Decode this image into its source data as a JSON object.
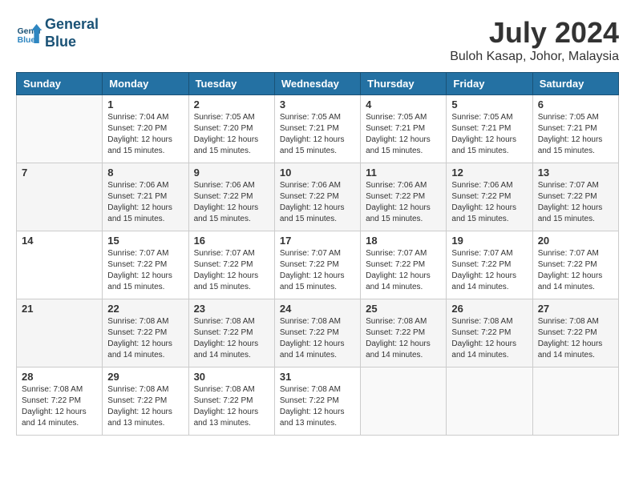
{
  "header": {
    "logo_line1": "General",
    "logo_line2": "Blue",
    "month_year": "July 2024",
    "location": "Buloh Kasap, Johor, Malaysia"
  },
  "days_of_week": [
    "Sunday",
    "Monday",
    "Tuesday",
    "Wednesday",
    "Thursday",
    "Friday",
    "Saturday"
  ],
  "weeks": [
    [
      {
        "day": "",
        "info": ""
      },
      {
        "day": "1",
        "info": "Sunrise: 7:04 AM\nSunset: 7:20 PM\nDaylight: 12 hours\nand 15 minutes."
      },
      {
        "day": "2",
        "info": "Sunrise: 7:05 AM\nSunset: 7:20 PM\nDaylight: 12 hours\nand 15 minutes."
      },
      {
        "day": "3",
        "info": "Sunrise: 7:05 AM\nSunset: 7:21 PM\nDaylight: 12 hours\nand 15 minutes."
      },
      {
        "day": "4",
        "info": "Sunrise: 7:05 AM\nSunset: 7:21 PM\nDaylight: 12 hours\nand 15 minutes."
      },
      {
        "day": "5",
        "info": "Sunrise: 7:05 AM\nSunset: 7:21 PM\nDaylight: 12 hours\nand 15 minutes."
      },
      {
        "day": "6",
        "info": "Sunrise: 7:05 AM\nSunset: 7:21 PM\nDaylight: 12 hours\nand 15 minutes."
      }
    ],
    [
      {
        "day": "7",
        "info": ""
      },
      {
        "day": "8",
        "info": "Sunrise: 7:06 AM\nSunset: 7:21 PM\nDaylight: 12 hours\nand 15 minutes."
      },
      {
        "day": "9",
        "info": "Sunrise: 7:06 AM\nSunset: 7:22 PM\nDaylight: 12 hours\nand 15 minutes."
      },
      {
        "day": "10",
        "info": "Sunrise: 7:06 AM\nSunset: 7:22 PM\nDaylight: 12 hours\nand 15 minutes."
      },
      {
        "day": "11",
        "info": "Sunrise: 7:06 AM\nSunset: 7:22 PM\nDaylight: 12 hours\nand 15 minutes."
      },
      {
        "day": "12",
        "info": "Sunrise: 7:06 AM\nSunset: 7:22 PM\nDaylight: 12 hours\nand 15 minutes."
      },
      {
        "day": "13",
        "info": "Sunrise: 7:07 AM\nSunset: 7:22 PM\nDaylight: 12 hours\nand 15 minutes."
      }
    ],
    [
      {
        "day": "14",
        "info": ""
      },
      {
        "day": "15",
        "info": "Sunrise: 7:07 AM\nSunset: 7:22 PM\nDaylight: 12 hours\nand 15 minutes."
      },
      {
        "day": "16",
        "info": "Sunrise: 7:07 AM\nSunset: 7:22 PM\nDaylight: 12 hours\nand 15 minutes."
      },
      {
        "day": "17",
        "info": "Sunrise: 7:07 AM\nSunset: 7:22 PM\nDaylight: 12 hours\nand 15 minutes."
      },
      {
        "day": "18",
        "info": "Sunrise: 7:07 AM\nSunset: 7:22 PM\nDaylight: 12 hours\nand 14 minutes."
      },
      {
        "day": "19",
        "info": "Sunrise: 7:07 AM\nSunset: 7:22 PM\nDaylight: 12 hours\nand 14 minutes."
      },
      {
        "day": "20",
        "info": "Sunrise: 7:07 AM\nSunset: 7:22 PM\nDaylight: 12 hours\nand 14 minutes."
      }
    ],
    [
      {
        "day": "21",
        "info": ""
      },
      {
        "day": "22",
        "info": "Sunrise: 7:08 AM\nSunset: 7:22 PM\nDaylight: 12 hours\nand 14 minutes."
      },
      {
        "day": "23",
        "info": "Sunrise: 7:08 AM\nSunset: 7:22 PM\nDaylight: 12 hours\nand 14 minutes."
      },
      {
        "day": "24",
        "info": "Sunrise: 7:08 AM\nSunset: 7:22 PM\nDaylight: 12 hours\nand 14 minutes."
      },
      {
        "day": "25",
        "info": "Sunrise: 7:08 AM\nSunset: 7:22 PM\nDaylight: 12 hours\nand 14 minutes."
      },
      {
        "day": "26",
        "info": "Sunrise: 7:08 AM\nSunset: 7:22 PM\nDaylight: 12 hours\nand 14 minutes."
      },
      {
        "day": "27",
        "info": "Sunrise: 7:08 AM\nSunset: 7:22 PM\nDaylight: 12 hours\nand 14 minutes."
      }
    ],
    [
      {
        "day": "28",
        "info": "Sunrise: 7:08 AM\nSunset: 7:22 PM\nDaylight: 12 hours\nand 14 minutes."
      },
      {
        "day": "29",
        "info": "Sunrise: 7:08 AM\nSunset: 7:22 PM\nDaylight: 12 hours\nand 13 minutes."
      },
      {
        "day": "30",
        "info": "Sunrise: 7:08 AM\nSunset: 7:22 PM\nDaylight: 12 hours\nand 13 minutes."
      },
      {
        "day": "31",
        "info": "Sunrise: 7:08 AM\nSunset: 7:22 PM\nDaylight: 12 hours\nand 13 minutes."
      },
      {
        "day": "",
        "info": ""
      },
      {
        "day": "",
        "info": ""
      },
      {
        "day": "",
        "info": ""
      }
    ]
  ]
}
